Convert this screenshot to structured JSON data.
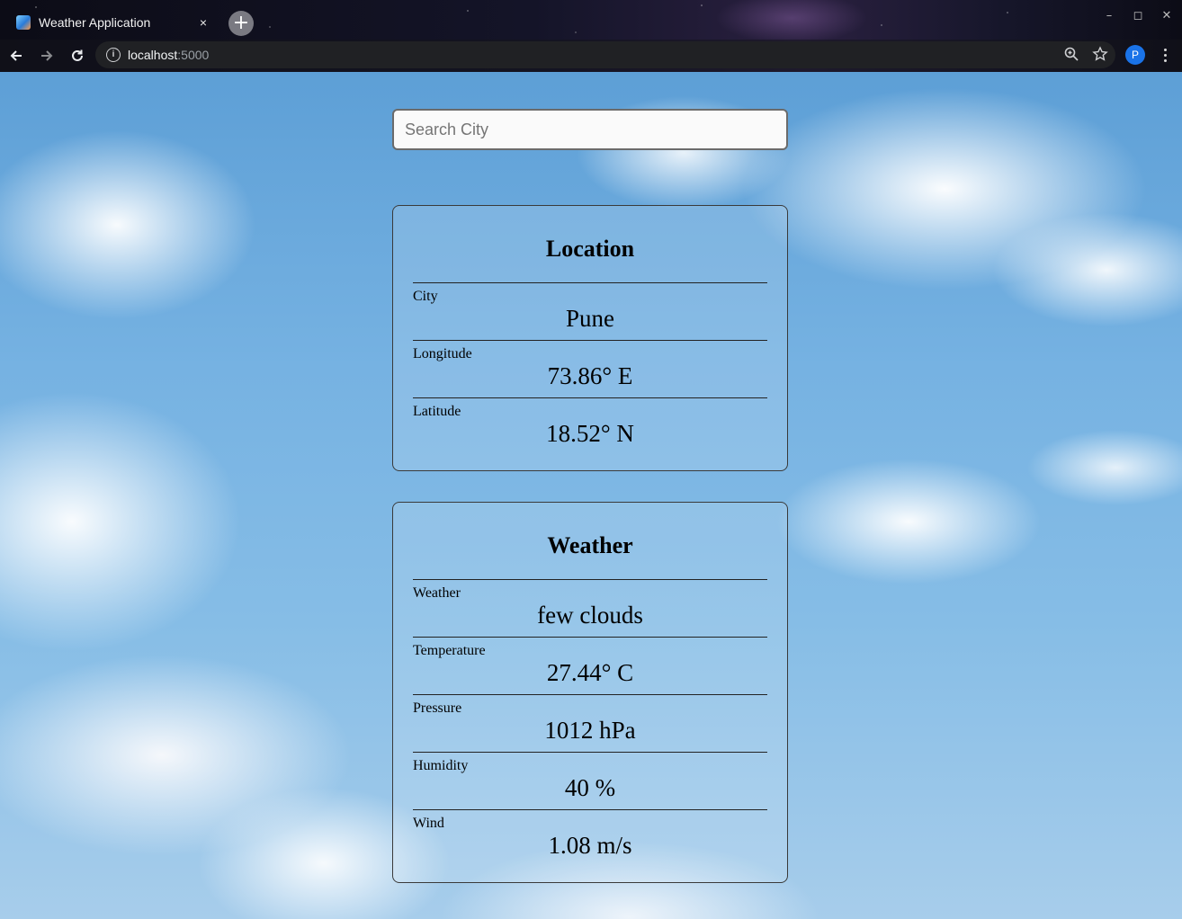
{
  "browser": {
    "tab_title": "Weather Application",
    "tab_close": "×",
    "new_tab": "+",
    "url_host": "localhost",
    "url_port": ":5000",
    "profile_initial": "P",
    "window_controls": [
      "–",
      "◻",
      "✕"
    ]
  },
  "search": {
    "placeholder": "Search City",
    "value": ""
  },
  "location": {
    "title": "Location",
    "rows": [
      {
        "label": "City",
        "value": "Pune"
      },
      {
        "label": "Longitude",
        "value": "73.86° E"
      },
      {
        "label": "Latitude",
        "value": "18.52° N"
      }
    ]
  },
  "weather": {
    "title": "Weather",
    "rows": [
      {
        "label": "Weather",
        "value": "few clouds"
      },
      {
        "label": "Temperature",
        "value": "27.44° C"
      },
      {
        "label": "Pressure",
        "value": "1012 hPa"
      },
      {
        "label": "Humidity",
        "value": "40 %"
      },
      {
        "label": "Wind",
        "value": "1.08 m/s"
      }
    ]
  },
  "colors": {
    "sky": "#76b2e2",
    "profile": "#1a73e8",
    "omnibox": "#202124"
  }
}
